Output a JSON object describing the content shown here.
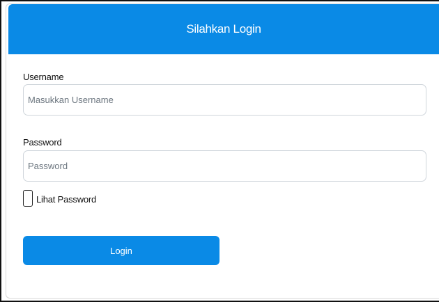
{
  "header": {
    "title": "Silahkan Login"
  },
  "form": {
    "username": {
      "label": "Username",
      "value": "",
      "placeholder": "Masukkan Username"
    },
    "password": {
      "label": "Password",
      "value": "",
      "placeholder": "Password"
    },
    "show_password": {
      "label": "Lihat Password",
      "checked": false
    },
    "submit_label": "Login"
  },
  "colors": {
    "accent": "#0a8ae6",
    "text": "#111111",
    "input_border": "#cfd5db",
    "placeholder": "#6d7780"
  }
}
